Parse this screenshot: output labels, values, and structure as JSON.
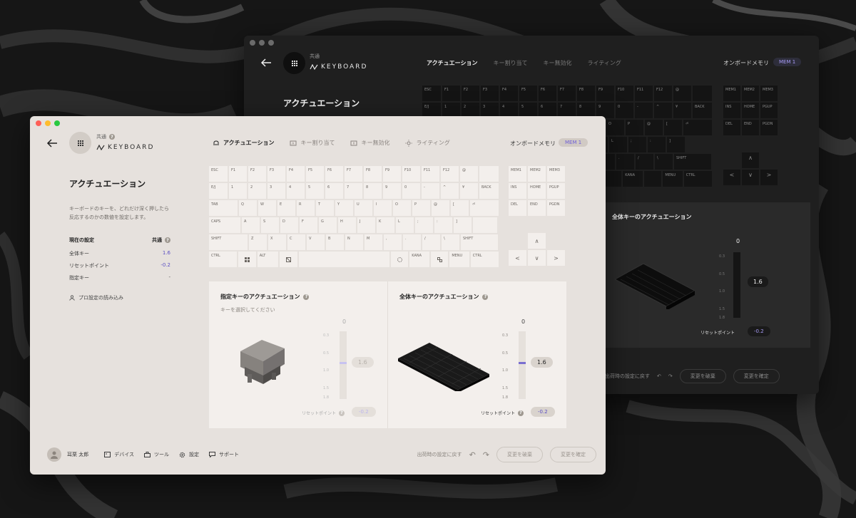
{
  "colors": {
    "accent": "#5b4fc4",
    "dark_bg": "#1f1f1f",
    "light_bg": "#e6e1dd"
  },
  "dark_window": {
    "brand_small": "共通",
    "brand": "KEYBOARD",
    "tabs": [
      "アクチュエーション",
      "キー割り当て",
      "キー無効化",
      "ライティング"
    ],
    "onboard_label": "オンボードメモリ",
    "mem_badge": "MEM 1",
    "page_title": "アクチュエーション",
    "panel_title": "全体キーのアクチュエーション",
    "zero": "0",
    "scale": [
      "0.3",
      "0.5",
      "1.0",
      "1.5",
      "1.8"
    ],
    "value": "1.6",
    "reset_label": "リセットポイント",
    "reset_value": "-0.2",
    "footer_revert": "出荷時の設定に戻す",
    "btn_discard": "変更を破棄",
    "btn_confirm": "変更を確定"
  },
  "light_window": {
    "brand_small": "共通",
    "brand": "KEYBOARD",
    "tabs": [
      "アクチュエーション",
      "キー割り当て",
      "キー無効化",
      "ライティング"
    ],
    "onboard_label": "オンボードメモリ",
    "mem_badge": "MEM 1",
    "page_title": "アクチュエーション",
    "description": "キーボードのキーを、どれだけ深く押したら反応するのかの数値を設定します。",
    "current": {
      "header": "現在の設定",
      "header_value": "共通",
      "rows": [
        {
          "label": "全体キー",
          "value": "1.6"
        },
        {
          "label": "リセットポイント",
          "value": "-0.2"
        },
        {
          "label": "指定キー",
          "value": "-"
        }
      ]
    },
    "pro_load": "プロ設定の読み込み",
    "keyboard": {
      "rows": [
        [
          "ESC",
          "F1",
          "F2",
          "F3",
          "F4",
          "F5",
          "F6",
          "F7",
          "F8",
          "F9",
          "F10",
          "F11",
          "F12",
          "@",
          ""
        ],
        [
          "E/J",
          "1",
          "2",
          "3",
          "4",
          "5",
          "6",
          "7",
          "8",
          "9",
          "0",
          "-",
          "^",
          "¥",
          "BACK"
        ],
        [
          "TAB",
          "Q",
          "W",
          "E",
          "R",
          "T",
          "Y",
          "U",
          "I",
          "O",
          "P",
          "@",
          "[",
          ""
        ],
        [
          "CAPS",
          "A",
          "S",
          "D",
          "F",
          "G",
          "H",
          "J",
          "K",
          "L",
          ";",
          ":",
          "]"
        ],
        [
          "SHIFT",
          "Z",
          "X",
          "C",
          "V",
          "B",
          "N",
          "M",
          ",",
          ".",
          "/",
          "\\",
          "SHIFT"
        ],
        [
          "CTRL",
          "",
          "ALT",
          "",
          "",
          "",
          "",
          "KANA",
          "",
          "MENU",
          "CTRL"
        ]
      ],
      "side": [
        [
          "MEM1",
          "MEM2",
          "MEM3"
        ],
        [
          "INS",
          "HOME",
          "PGUP"
        ],
        [
          "DEL",
          "END",
          "PGDN"
        ]
      ],
      "arrows": {
        "up": "∧",
        "left": "<",
        "down": "∨",
        "right": ">"
      }
    },
    "panel_specified": {
      "title": "指定キーのアクチュエーション",
      "subtitle": "キーを選択してください",
      "zero": "0",
      "scale": [
        "0.3",
        "0.5",
        "1.0",
        "1.5",
        "1.8"
      ],
      "value": "1.6",
      "reset_label": "リセットポイント",
      "reset_value": "-0.2"
    },
    "panel_global": {
      "title": "全体キーのアクチュエーション",
      "zero": "0",
      "scale": [
        "0.3",
        "0.5",
        "1.0",
        "1.5",
        "1.8"
      ],
      "value": "1.6",
      "reset_label": "リセットポイント",
      "reset_value": "-0.2"
    },
    "footer": {
      "user": "耳栗 太郎",
      "nav": [
        "デバイス",
        "ツール",
        "設定",
        "サポート"
      ],
      "revert": "出荷時の設定に戻す",
      "btn_discard": "変更を破棄",
      "btn_confirm": "変更を確定"
    }
  }
}
